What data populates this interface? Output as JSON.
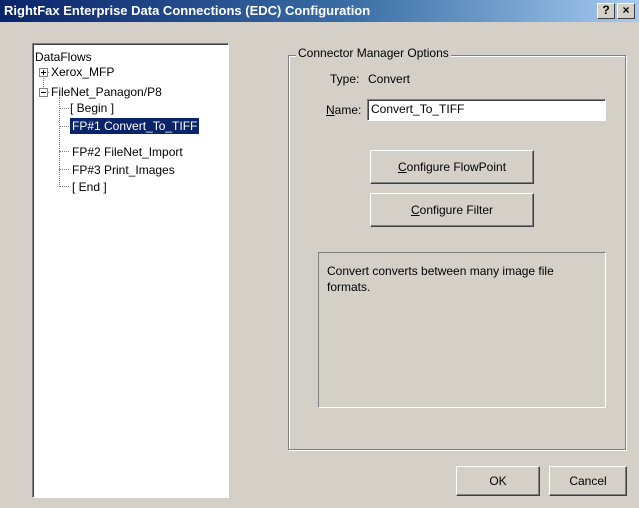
{
  "window": {
    "title": "RightFax Enterprise Data Connections (EDC) Configuration",
    "help_glyph": "?",
    "close_glyph": "×"
  },
  "tree": {
    "root": "DataFlows",
    "items": [
      {
        "label": "Xerox_MFP",
        "state": "collapsed"
      },
      {
        "label": "FileNet_Panagon/P8",
        "state": "expanded",
        "children": [
          "[ Begin ]",
          "FP#1 Convert_To_TIFF",
          "FP#2 FileNet_Import",
          "FP#3 Print_Images",
          "[ End ]"
        ]
      }
    ],
    "selected": "FP#1 Convert_To_TIFF"
  },
  "options": {
    "group_title": "Connector Manager Options",
    "type_label": "Type:",
    "type_value": "Convert",
    "name_label_mnemonic": "N",
    "name_label_rest": "ame:",
    "name_value": "Convert_To_TIFF",
    "configure_flowpoint_mnemonic": "C",
    "configure_flowpoint_rest": "onfigure FlowPoint",
    "configure_filter_mnemonic": "C",
    "configure_filter_rest": "onfigure Filter",
    "description": "Convert converts between many image file formats."
  },
  "buttons": {
    "ok": "OK",
    "cancel": "Cancel"
  }
}
